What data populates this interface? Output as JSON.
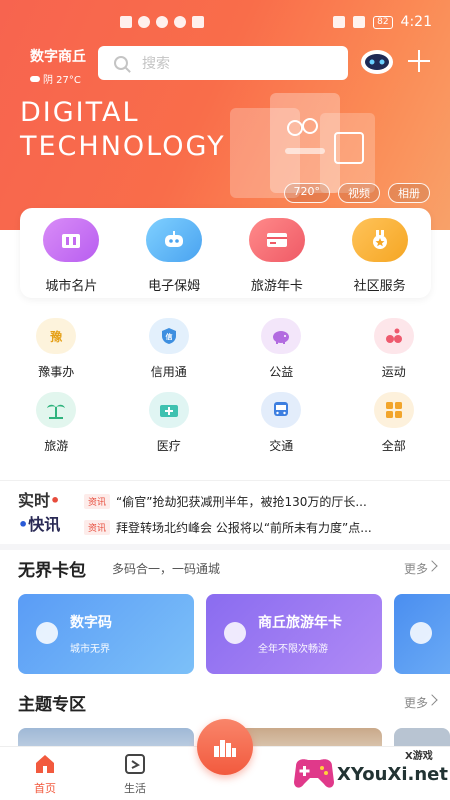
{
  "status_bar": {
    "battery": "82",
    "time": "4:21"
  },
  "header": {
    "city": "数字商丘",
    "weather": "阴 27°C",
    "search_placeholder": "搜索",
    "hero_title_line1": "DIGITAL",
    "hero_title_line2": "TECHNOLOGY",
    "hero_tags": [
      "720°",
      "视频",
      "相册"
    ]
  },
  "main_services": [
    {
      "label": "城市名片",
      "icon": "city-card-icon",
      "color": "#c46bf0"
    },
    {
      "label": "电子保姆",
      "icon": "robot-nanny-icon",
      "color": "#5ab6f5"
    },
    {
      "label": "旅游年卡",
      "icon": "travel-card-icon",
      "color": "#f0626a"
    },
    {
      "label": "社区服务",
      "icon": "community-medal-icon",
      "color": "#f5a623"
    }
  ],
  "grid_services": [
    {
      "label": "豫事办",
      "icon": "yu-icon",
      "glyph": "豫"
    },
    {
      "label": "信用通",
      "icon": "credit-shield-icon",
      "glyph": "信"
    },
    {
      "label": "公益",
      "icon": "piggy-bank-icon",
      "glyph": ""
    },
    {
      "label": "运动",
      "icon": "sport-icon",
      "glyph": ""
    },
    {
      "label": "旅游",
      "icon": "palm-tree-icon",
      "glyph": ""
    },
    {
      "label": "医疗",
      "icon": "medical-kit-icon",
      "glyph": ""
    },
    {
      "label": "交通",
      "icon": "bus-icon",
      "glyph": ""
    },
    {
      "label": "全部",
      "icon": "all-grid-icon",
      "glyph": ""
    }
  ],
  "news": {
    "logo_line1": "实时",
    "logo_line2": "快讯",
    "items": [
      {
        "tag": "资讯",
        "text": "“偷官”抢劫犯获减刑半年，被抢130万的厅长..."
      },
      {
        "tag": "资讯",
        "text": "拜登转场北约峰会 公报将以“前所未有力度”点..."
      }
    ]
  },
  "card_wallet": {
    "title": "无界卡包",
    "subtitle": "多码合一，一码通城",
    "more": "更多",
    "cards": [
      {
        "title": "数字码",
        "sub": "城市无界"
      },
      {
        "title": "商丘旅游年卡",
        "sub": "全年不限次畅游"
      }
    ]
  },
  "theme_zone": {
    "title": "主题专区",
    "more": "更多"
  },
  "tabbar": {
    "tabs": [
      {
        "label": "首页"
      },
      {
        "label": "生活"
      }
    ]
  },
  "watermark": {
    "text": "XYouXi.net",
    "small": "X游戏"
  },
  "colors": {
    "accent": "#f25a3e",
    "hero_start": "#f7644f",
    "hero_end": "#f8a26a"
  }
}
